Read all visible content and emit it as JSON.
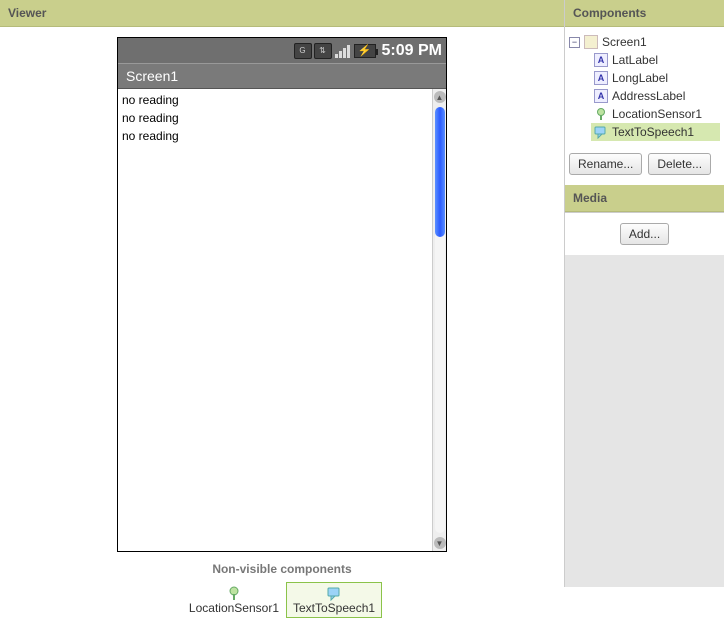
{
  "viewer": {
    "title": "Viewer",
    "phone": {
      "time": "5:09 PM",
      "screen_title": "Screen1",
      "labels": [
        "no reading",
        "no reading",
        "no reading"
      ]
    },
    "nonvisible": {
      "title": "Non-visible components",
      "items": [
        {
          "name": "LocationSensor1",
          "icon": "location-icon",
          "selected": false
        },
        {
          "name": "TextToSpeech1",
          "icon": "tts-icon",
          "selected": true
        }
      ]
    }
  },
  "components": {
    "title": "Components",
    "root": {
      "name": "Screen1",
      "children": [
        {
          "name": "LatLabel",
          "icon": "label-icon"
        },
        {
          "name": "LongLabel",
          "icon": "label-icon"
        },
        {
          "name": "AddressLabel",
          "icon": "label-icon"
        },
        {
          "name": "LocationSensor1",
          "icon": "location-icon"
        },
        {
          "name": "TextToSpeech1",
          "icon": "tts-icon",
          "selected": true
        }
      ]
    },
    "buttons": {
      "rename": "Rename...",
      "delete": "Delete..."
    }
  },
  "media": {
    "title": "Media",
    "add": "Add..."
  }
}
